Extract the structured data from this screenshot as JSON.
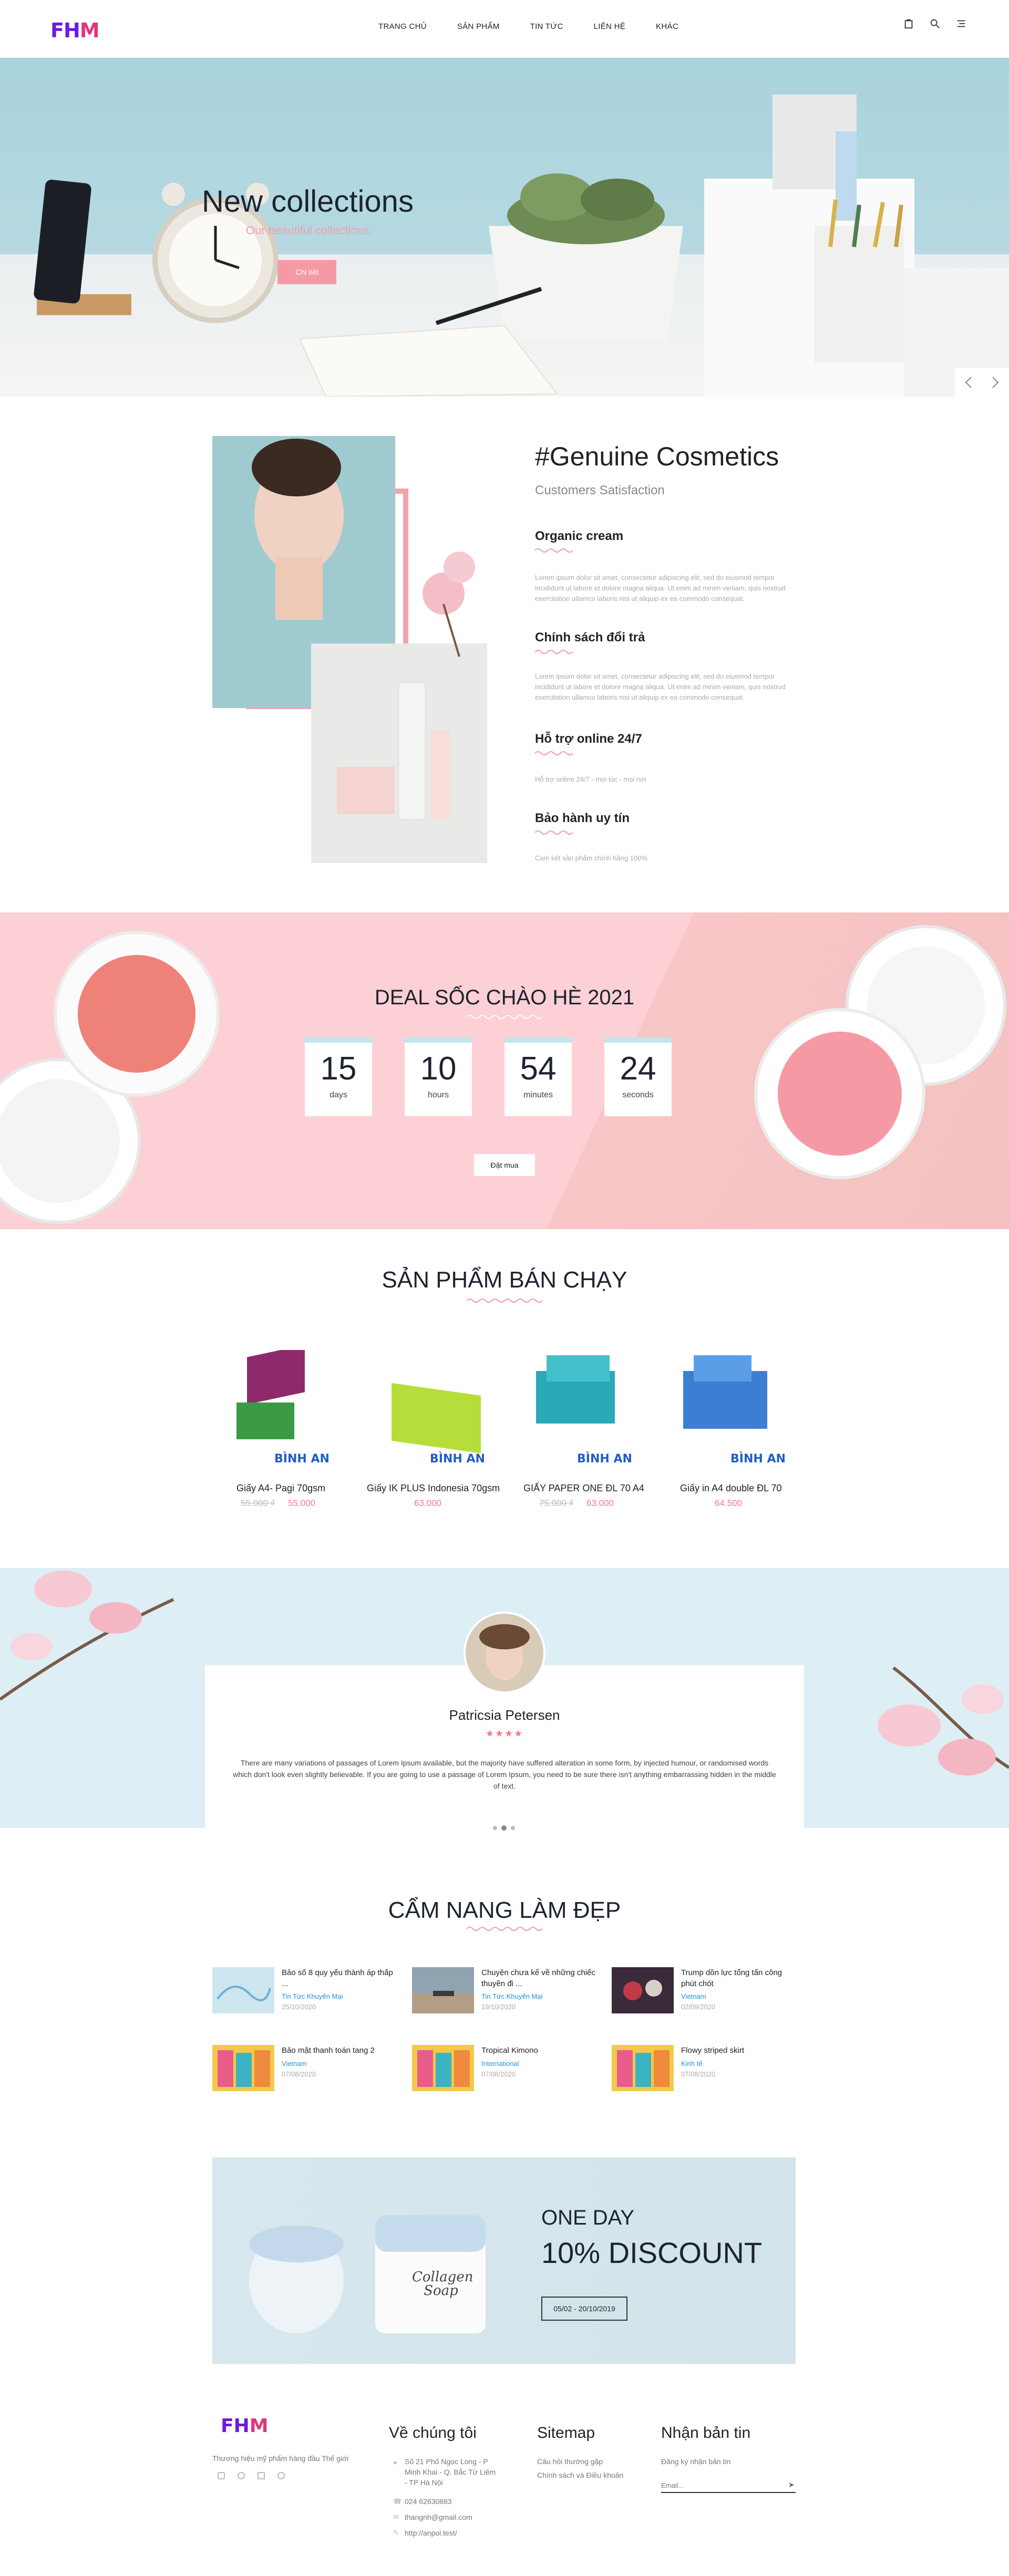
{
  "header": {
    "logo_part1": "FH",
    "logo_part2": "M",
    "nav": [
      "TRANG CHỦ",
      "SẢN PHẨM",
      "TIN TỨC",
      "LIÊN HỆ",
      "KHÁC"
    ]
  },
  "hero": {
    "title": "New collections",
    "subtitle": "Our beautiful collections",
    "button": "Chi tiết"
  },
  "genuine": {
    "title": "#Genuine Cosmetics",
    "subtitle": "Customers Satisfaction",
    "features": [
      {
        "title": "Organic cream",
        "text": "Lorem ipsum dolor sit amet, consectetur adipiscing elit, sed do eiusmod tempor incididunt ut labore et dolore magna aliqua. Ut enim ad minim veniam, quis nostrud exercitation ullamco laboris nisi ut aliquip ex ea commodo consequat."
      },
      {
        "title": "Chính sách đổi trả",
        "text": "Lorem ipsum dolor sit amet, consectetur adipiscing elit, sed do eiusmod tempor incididunt ut labore et dolore magna aliqua. Ut enim ad minim veniam, quis nostrud exercitation ullamco laboris nisi ut aliquip ex ea commodo consequat."
      },
      {
        "title": "Hỗ trợ online 24/7",
        "text": "Hỗ trợ online 24/7 - mọi lúc - mọi nơi"
      },
      {
        "title": "Bảo hành uy tín",
        "text": "Cam kết sản phẩm chính hãng 100%"
      }
    ]
  },
  "deal": {
    "title": "DEAL SỐC CHÀO HÈ 2021",
    "countdown": [
      {
        "value": "15",
        "label": "days"
      },
      {
        "value": "10",
        "label": "hours"
      },
      {
        "value": "54",
        "label": "minutes"
      },
      {
        "value": "24",
        "label": "seconds"
      }
    ],
    "button": "Đặt mua"
  },
  "bestsellers": {
    "title": "SẢN PHẨM BÁN CHẠY",
    "brand": "BÌNH AN",
    "products": [
      {
        "name": "Giấy A4- Pagi 70gsm",
        "old_price": "55.000 ₫",
        "price": "55.000"
      },
      {
        "name": "Giấy IK PLUS Indonesia 70gsm",
        "old_price": "",
        "price": "63.000"
      },
      {
        "name": "GIẤY PAPER ONE ĐL 70 A4",
        "old_price": "75.000 ₫",
        "price": "63.000"
      },
      {
        "name": "Giấy in A4 double ĐL 70",
        "old_price": "",
        "price": "64.500"
      }
    ]
  },
  "testimonial": {
    "name": "Patricsia Petersen",
    "stars": "★★★★",
    "text": "There are many variations of passages of Lorem Ipsum available, but the majority have suffered alteration in some form, by injected humour, or randomised words which don't look even slightly believable. If you are going to use a passage of Lorem Ipsum, you need to be sure there isn't anything embarrassing hidden in the middle of text."
  },
  "blog": {
    "title": "CẨM NANG LÀM ĐẸP",
    "posts": [
      {
        "title": "Bảo số 8 quy yếu thành áp thấp ...",
        "category": "Tin Tức Khuyến Mại",
        "date": "25/10/2020"
      },
      {
        "title": "Chuyện chưa kể về những chiếc thuyền đi ...",
        "category": "Tin Tức Khuyến Mại",
        "date": "19/10/2020"
      },
      {
        "title": "Trump dồn lực tổng tấn công phút chót",
        "category": "Vietnam",
        "date": "02/09/2020"
      },
      {
        "title": "Bảo mật thanh toán tang 2",
        "category": "Vietnam",
        "date": "07/08/2020"
      },
      {
        "title": "Tropical Kimono",
        "category": "International",
        "date": "07/08/2020"
      },
      {
        "title": "Flowy striped skirt",
        "category": "Kinh tế",
        "date": "07/08/2020"
      }
    ]
  },
  "promo": {
    "line1": "ONE DAY",
    "line2": "10% DISCOUNT",
    "dates": "05/02 - 20/10/2019",
    "jar_text": "Collagen Soap"
  },
  "footer": {
    "tagline": "Thương hiệu mỹ phẩm hàng đầu Thế giới",
    "about_title": "Về chúng tôi",
    "address": "Số 21 Phố Ngọc Long - P Minh Khai - Q. Bắc Từ Liêm - TP Hà Nội",
    "phone": "024 62630883",
    "email": "thangnh@gmail.com",
    "website": "http://anpoi.test/",
    "sitemap_title": "Sitemap",
    "sitemap_links": [
      "Câu hỏi thường gặp",
      "Chính sách và Điều khoản"
    ],
    "newsletter_title": "Nhận bản tin",
    "newsletter_text": "Đăng ký nhận bản tin",
    "email_placeholder": "Email..."
  },
  "colors": {
    "accent": "#f59aa5",
    "price": "#f07a8b",
    "link": "#1f8fe0",
    "hero_bg": "#a9d3de",
    "deal_bg": "#fcd0d4"
  }
}
